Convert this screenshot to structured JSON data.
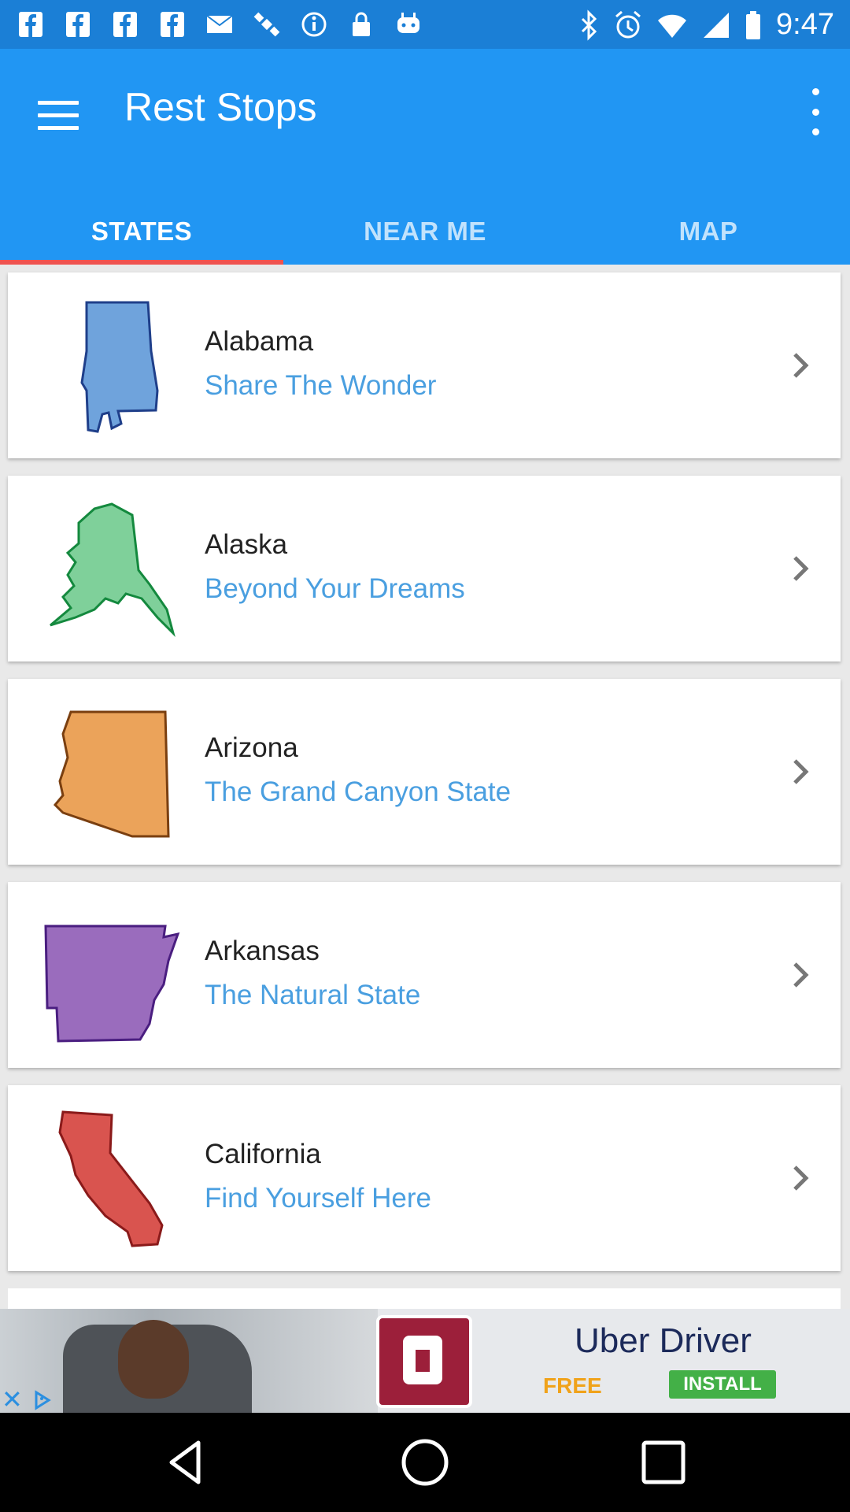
{
  "status_bar": {
    "time": "9:47",
    "icons": [
      "facebook-icon",
      "facebook-icon",
      "facebook-icon",
      "facebook-icon",
      "email-icon",
      "satellite-icon",
      "info-icon",
      "lock-icon",
      "robot-icon",
      "bluetooth-icon",
      "alarm-icon",
      "wifi-icon",
      "signal-icon",
      "battery-icon"
    ]
  },
  "app_bar": {
    "title": "Rest Stops",
    "menu_icon": "hamburger-icon",
    "overflow_icon": "more-vert-icon",
    "color": "#2196f3"
  },
  "tabs": [
    {
      "label": "STATES",
      "active": true
    },
    {
      "label": "NEAR ME",
      "active": false
    },
    {
      "label": "MAP",
      "active": false
    }
  ],
  "accent_color": "#ef5350",
  "states": [
    {
      "name": "Alabama",
      "motto": "Share The Wonder",
      "color": "#6fa3dc"
    },
    {
      "name": "Alaska",
      "motto": "Beyond Your Dreams",
      "color": "#7fd09a"
    },
    {
      "name": "Arizona",
      "motto": "The Grand Canyon State",
      "color": "#eba35a"
    },
    {
      "name": "Arkansas",
      "motto": "The Natural State",
      "color": "#9a6cbd"
    },
    {
      "name": "California",
      "motto": "Find Yourself Here",
      "color": "#d9544f"
    }
  ],
  "ad": {
    "brand": "Uber Driver",
    "free": "FREE",
    "install": "INSTALL"
  },
  "nav_bar": {
    "buttons": [
      "back-icon",
      "home-icon",
      "recents-icon"
    ]
  }
}
